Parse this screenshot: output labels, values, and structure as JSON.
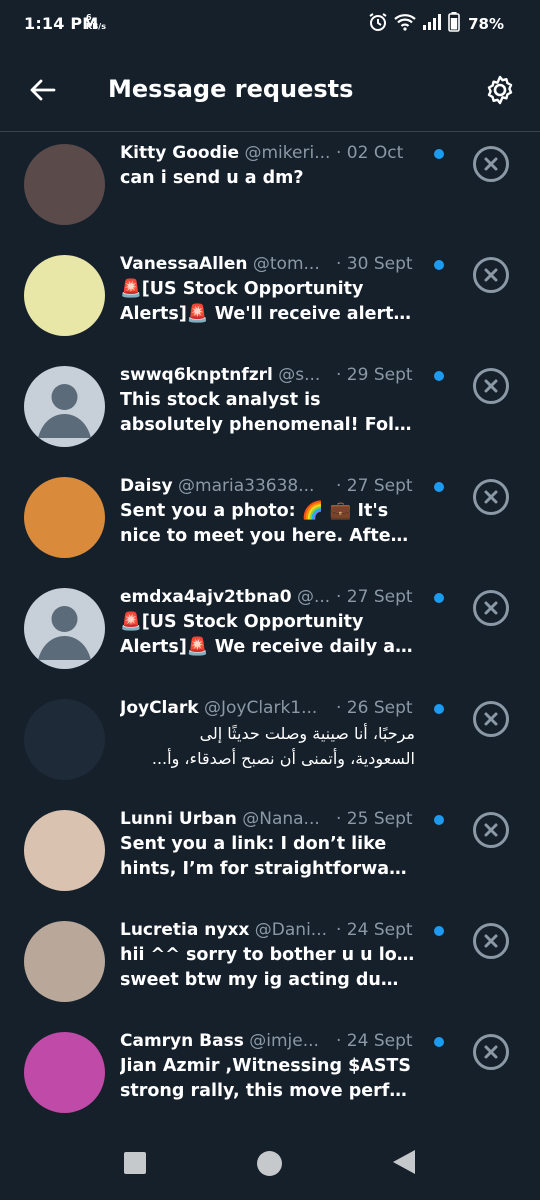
{
  "status_bar": {
    "time": "1:14 PM",
    "speed_value": "6",
    "speed_unit": "KB/s",
    "battery": "78%"
  },
  "header": {
    "title": "Message requests"
  },
  "requests": [
    {
      "name": "Kitty Goodie",
      "handle": "@mikeri...",
      "date": "· 02 Oct",
      "lines": [
        "can i send u a dm?"
      ],
      "avatar_color": "#5a4a4a"
    },
    {
      "name": "VanessaAllen",
      "handle": "@tom...",
      "date": "· 30 Sept",
      "lines": [
        "🚨[US Stock Opportunity",
        "Alerts]🚨 We'll receive alerts ..."
      ],
      "avatar_color": "#e8e7a8"
    },
    {
      "name": "swwq6knptnfzrl",
      "handle": "@s...",
      "date": "· 29 Sept",
      "lines": [
        "This stock analyst is",
        "absolutely phenomenal! Foll..."
      ],
      "avatar_color": "#c7d0d9"
    },
    {
      "name": "Daisy",
      "handle": "@maria33638...",
      "date": "· 27 Sept",
      "lines": [
        "Sent you a photo: 🌈 💼 It's",
        "nice to meet you here. After l..."
      ],
      "avatar_color": "#d98a3a"
    },
    {
      "name": "emdxa4ajv2tbna0",
      "handle": "@...",
      "date": "· 27 Sept",
      "lines": [
        "🚨[US Stock Opportunity",
        "Alerts]🚨 We receive daily ale..."
      ],
      "avatar_color": "#c7d0d9"
    },
    {
      "name": "JoyClark",
      "handle": "@JoyClark1...",
      "date": "· 26 Sept",
      "lines": [
        "مرحبًا، أنا صينية وصلت حديثًا إلى",
        "السعودية، وأتمنى أن نصبح أصدقاء، وأ..."
      ],
      "avatar_color": "#1e2a38",
      "rtl": true
    },
    {
      "name": "Lunni Urban",
      "handle": "@Nana...",
      "date": "· 25 Sept",
      "lines": [
        "Sent you a link: I don’t like",
        "hints, I’m for straightforward..."
      ],
      "avatar_color": "#d9c2b0"
    },
    {
      "name": "Lucretia nyxx",
      "handle": "@Dani...",
      "date": "· 24 Sept",
      "lines": [
        "hii ^^ sorry to bother u u look",
        "sweet btw my ig acting dumb ..."
      ],
      "avatar_color": "#b9a89a"
    },
    {
      "name": "Camryn Bass",
      "handle": "@imje...",
      "date": "· 24 Sept",
      "lines": [
        "Jian Azmir ,Witnessing $ASTS",
        "strong rally, this move perfec..."
      ],
      "avatar_color": "#c04aa8"
    }
  ],
  "colors": {
    "background": "#15202b",
    "accent": "#1d9bf0",
    "secondary_text": "#8b98a5"
  }
}
